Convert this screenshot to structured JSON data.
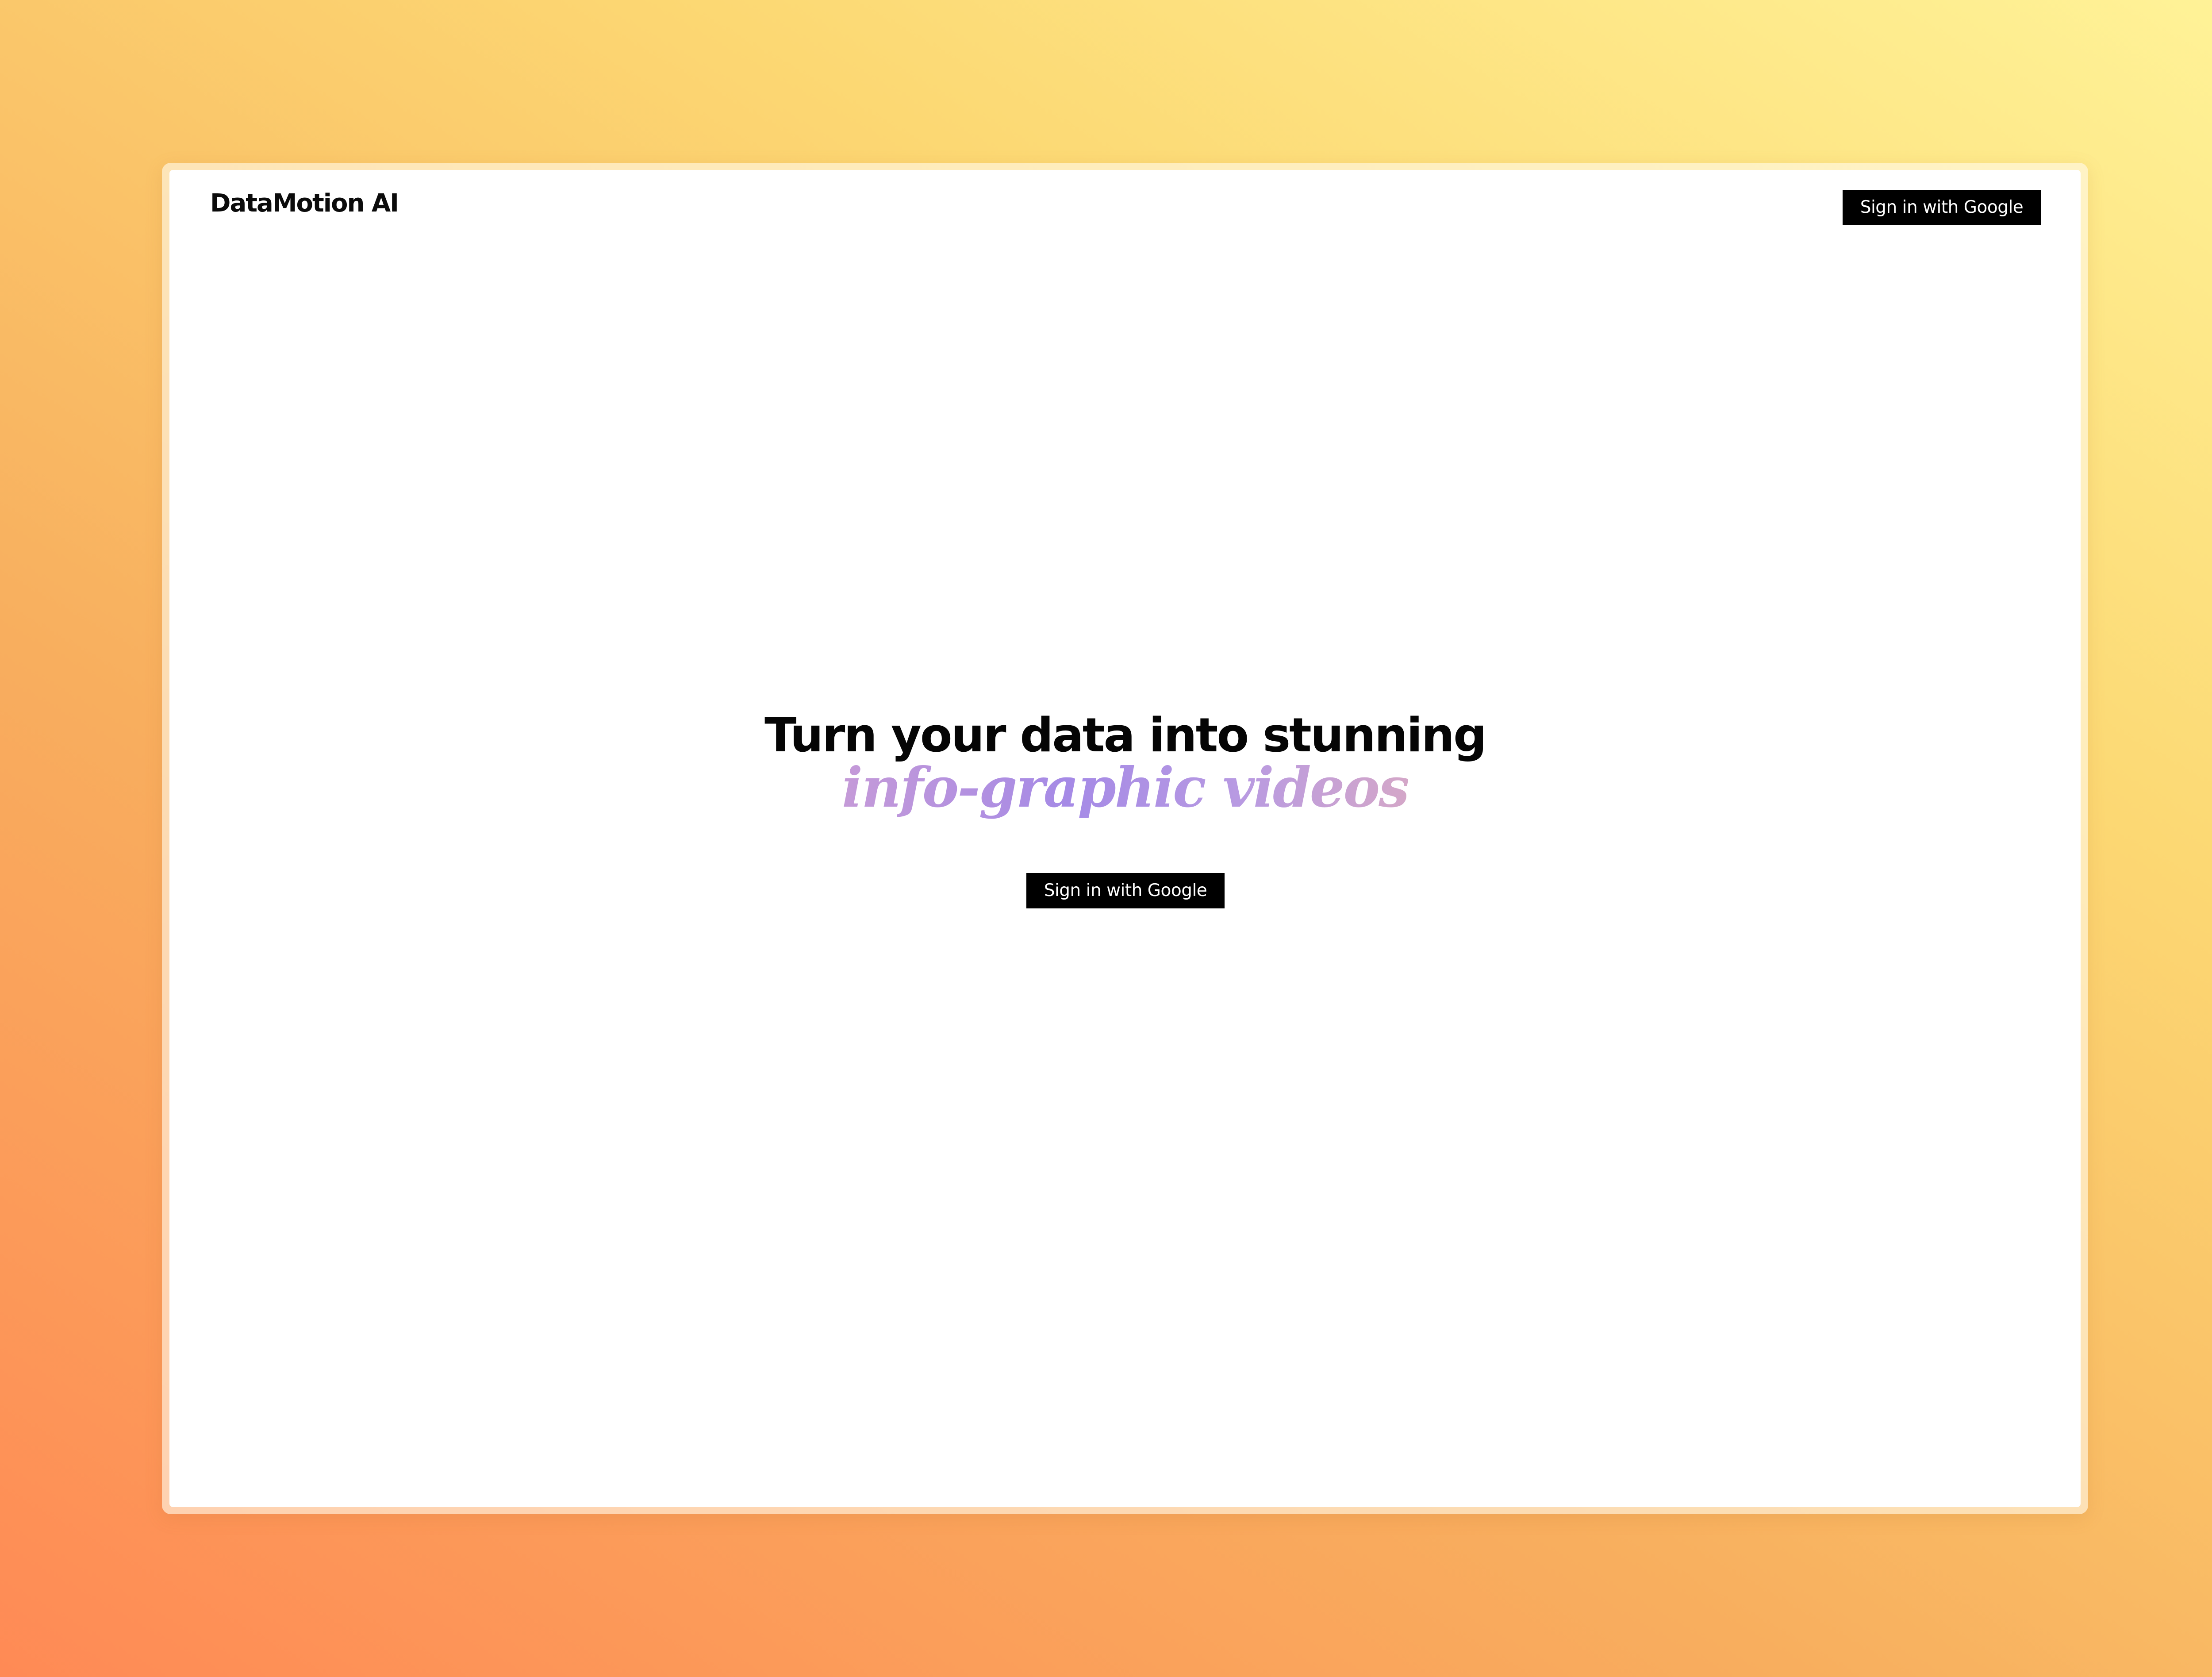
{
  "header": {
    "brand": "DataMotion AI",
    "signin_label": "Sign in with Google"
  },
  "hero": {
    "title": "Turn your data into stunning",
    "subtitle": "info-graphic videos",
    "signin_label": "Sign in with Google"
  },
  "colors": {
    "background_gradient": [
      "#ff8a55",
      "#fff398"
    ],
    "button_bg": "#000000",
    "button_text": "#ffffff",
    "subtitle_gradient": [
      "#c59ad8",
      "#a58ae6",
      "#d4a7c8"
    ]
  }
}
